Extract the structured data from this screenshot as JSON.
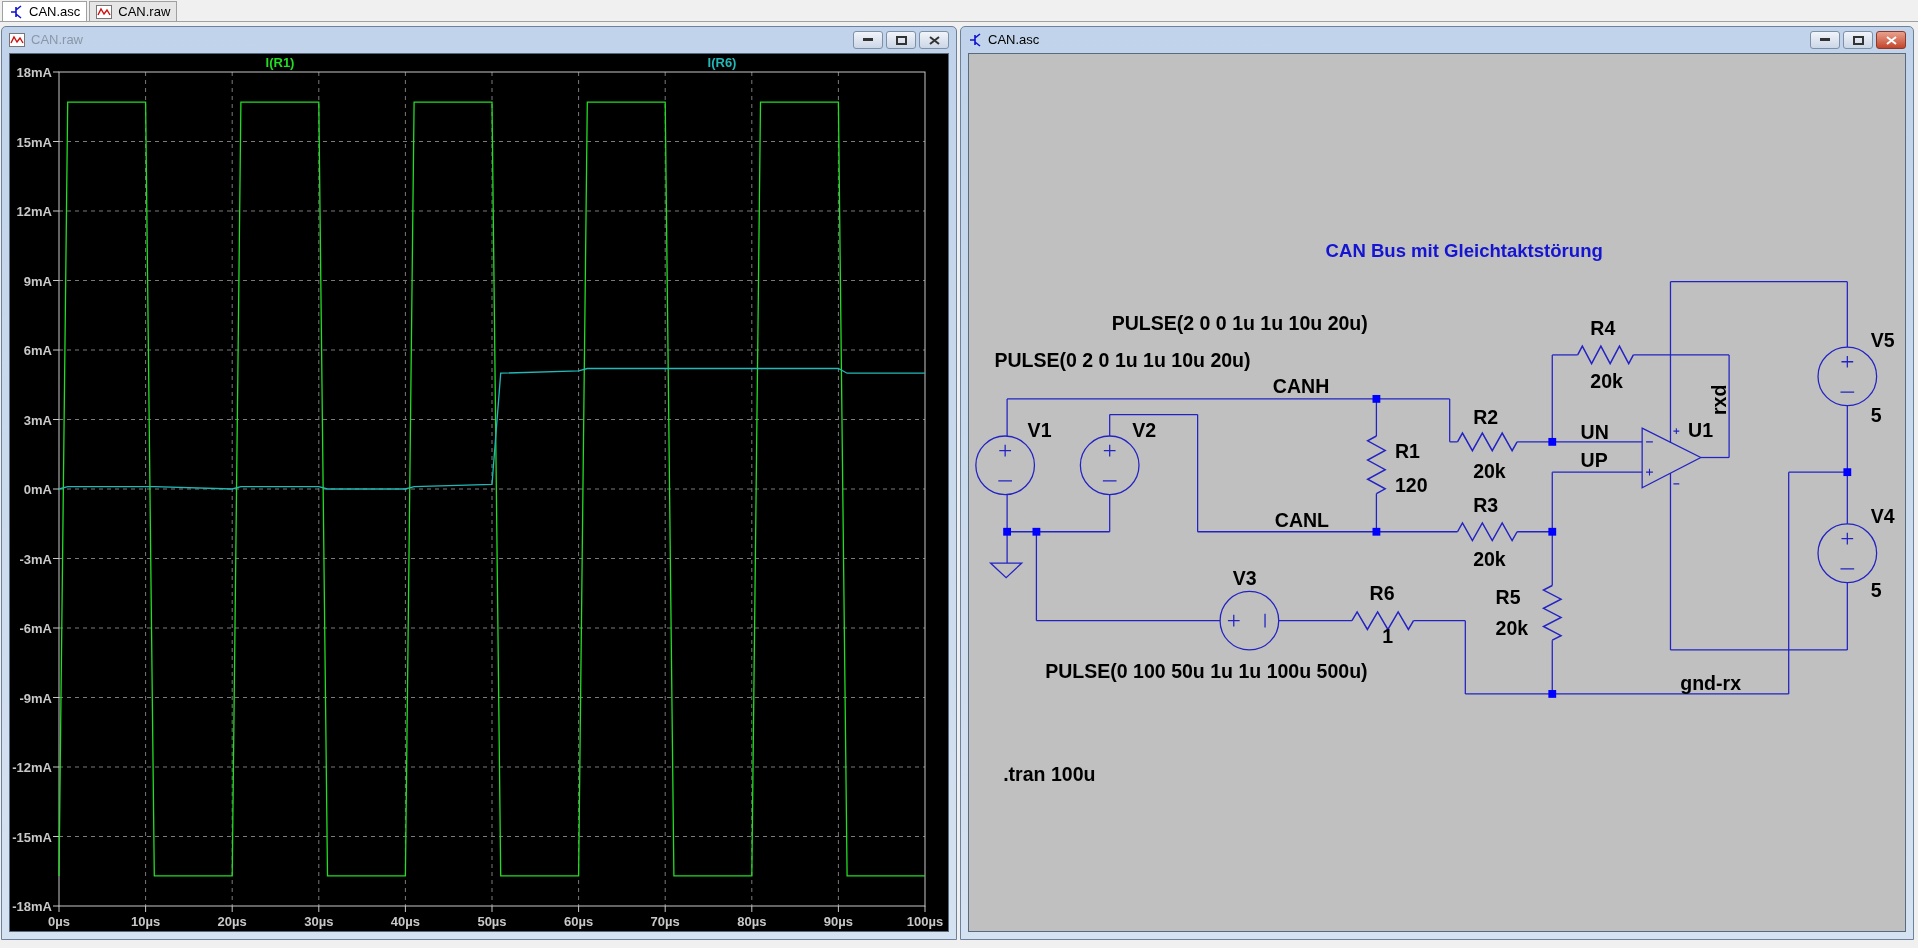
{
  "tabs": [
    {
      "label": "CAN.asc",
      "kind": "schematic",
      "selected": true
    },
    {
      "label": "CAN.raw",
      "kind": "waveform",
      "selected": false
    }
  ],
  "waveform_window": {
    "title": "CAN.raw",
    "kind": "waveform",
    "active": false,
    "chart_data": {
      "type": "line",
      "grid": true,
      "x": [
        0,
        1,
        10,
        11,
        20,
        21,
        30,
        31,
        40,
        41,
        50,
        51,
        60,
        61,
        70,
        71,
        80,
        81,
        90,
        91,
        100
      ],
      "series": [
        {
          "name": "I(R1)",
          "color": "#22dd22",
          "values": [
            -16.7,
            16.7,
            16.7,
            -16.7,
            -16.7,
            16.7,
            16.7,
            -16.7,
            -16.7,
            16.7,
            16.7,
            -16.7,
            -16.7,
            16.7,
            16.7,
            -16.7,
            -16.7,
            16.7,
            16.7,
            -16.7,
            -16.7
          ]
        },
        {
          "name": "I(R6)",
          "color": "#22b8b8",
          "values": [
            0,
            0.1,
            0.1,
            0.1,
            0,
            0.1,
            0.1,
            0,
            0,
            0.1,
            0.2,
            5,
            5.1,
            5.2,
            5.2,
            5.2,
            5.2,
            5.2,
            5.2,
            5,
            5
          ]
        }
      ],
      "xlim": [
        0,
        100
      ],
      "ylim": [
        -18,
        18
      ],
      "xticks": [
        {
          "value": 0,
          "label": "0µs"
        },
        {
          "value": 10,
          "label": "10µs"
        },
        {
          "value": 20,
          "label": "20µs"
        },
        {
          "value": 30,
          "label": "30µs"
        },
        {
          "value": 40,
          "label": "40µs"
        },
        {
          "value": 50,
          "label": "50µs"
        },
        {
          "value": 60,
          "label": "60µs"
        },
        {
          "value": 70,
          "label": "70µs"
        },
        {
          "value": 80,
          "label": "80µs"
        },
        {
          "value": 90,
          "label": "90µs"
        },
        {
          "value": 100,
          "label": "100µs"
        }
      ],
      "yticks": [
        {
          "value": 18,
          "label": "18mA"
        },
        {
          "value": 15,
          "label": "15mA"
        },
        {
          "value": 12,
          "label": "12mA"
        },
        {
          "value": 9,
          "label": "9mA"
        },
        {
          "value": 6,
          "label": "6mA"
        },
        {
          "value": 3,
          "label": "3mA"
        },
        {
          "value": 0,
          "label": "0mA"
        },
        {
          "value": -3,
          "label": "-3mA"
        },
        {
          "value": -6,
          "label": "-6mA"
        },
        {
          "value": -9,
          "label": "-9mA"
        },
        {
          "value": -12,
          "label": "-12mA"
        },
        {
          "value": -15,
          "label": "-15mA"
        },
        {
          "value": -18,
          "label": "-18mA"
        }
      ]
    }
  },
  "schematic_window": {
    "title": "CAN.asc",
    "kind": "schematic",
    "active": true,
    "schematic": {
      "title": "CAN Bus mit Gleichtaktstörung",
      "components": [
        {
          "ref": "V1",
          "kind": "voltage_source"
        },
        {
          "ref": "V2",
          "kind": "voltage_source"
        },
        {
          "ref": "R1",
          "kind": "resistor",
          "value": "120"
        },
        {
          "ref": "R2",
          "kind": "resistor",
          "value": "20k"
        },
        {
          "ref": "R3",
          "kind": "resistor",
          "value": "20k"
        },
        {
          "ref": "R4",
          "kind": "resistor",
          "value": "20k"
        },
        {
          "ref": "R5",
          "kind": "resistor",
          "value": "20k"
        },
        {
          "ref": "R6",
          "kind": "resistor",
          "value": "1"
        },
        {
          "ref": "V3",
          "kind": "voltage_source"
        },
        {
          "ref": "U1",
          "kind": "opamp"
        },
        {
          "ref": "V5",
          "kind": "voltage_source",
          "value": "5"
        },
        {
          "ref": "V4",
          "kind": "voltage_source",
          "value": "5"
        }
      ],
      "net_labels": [
        "CANH",
        "CANL",
        "UN",
        "UP",
        "rxd",
        "gnd-rx"
      ],
      "source_specs": [
        "PULSE(2 0 0 1u 1u 10u 20u)",
        "PULSE(0 2 0 1u 1u 10u 20u)",
        "PULSE(0 100 50u 1u 1u 100u 500u)"
      ],
      "directives": [
        ".tran 100u"
      ]
    }
  }
}
